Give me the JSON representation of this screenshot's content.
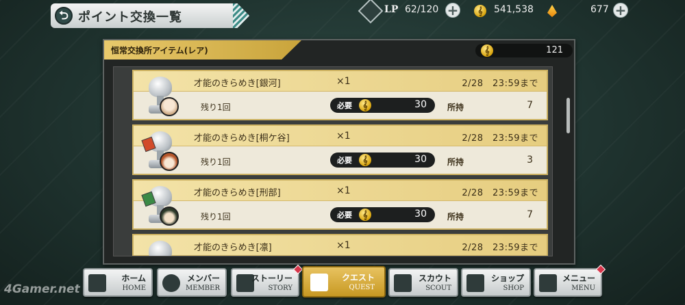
{
  "header": {
    "title": "ポイント交換一覧",
    "back_symbol": "⮌",
    "lp_label": "LP",
    "lp_value": "62/120",
    "coins_value": "541,538",
    "gems_value": "677",
    "plus_symbol": "+"
  },
  "panel": {
    "banner": "恒常交換所アイテム(レア)",
    "currency_value": "121",
    "currency_icon": "treble-clef-coin-icon",
    "coin_glyph": "𝄞"
  },
  "items": [
    {
      "name": "才能のきらめき[銀河]",
      "qty": "×1",
      "deadline": "2/28　23:59まで",
      "remaining": "残り1回",
      "required_label": "必要",
      "cost": "30",
      "owned_label": "所持",
      "owned": "7"
    },
    {
      "name": "才能のきらめき[桐ケ谷]",
      "qty": "×1",
      "deadline": "2/28　23:59まで",
      "remaining": "残り1回",
      "required_label": "必要",
      "cost": "30",
      "owned_label": "所持",
      "owned": "3"
    },
    {
      "name": "才能のきらめき[刑部]",
      "qty": "×1",
      "deadline": "2/28　23:59まで",
      "remaining": "残り1回",
      "required_label": "必要",
      "cost": "30",
      "owned_label": "所持",
      "owned": "7"
    },
    {
      "name": "才能のきらめき[凛]",
      "qty": "×1",
      "deadline": "2/28　23:59まで"
    }
  ],
  "nav": [
    {
      "jp": "ホーム",
      "en": "HOME"
    },
    {
      "jp": "メンバー",
      "en": "MEMBER"
    },
    {
      "jp": "ストーリー",
      "en": "STORY"
    },
    {
      "jp": "クエスト",
      "en": "QUEST"
    },
    {
      "jp": "スカウト",
      "en": "SCOUT"
    },
    {
      "jp": "ショップ",
      "en": "SHOP"
    },
    {
      "jp": "メニュー",
      "en": "MENU"
    }
  ],
  "watermark": "4Gamer.net",
  "colors": {
    "accent_gold": "#e6cd7f",
    "background": "#1f332f",
    "notification": "#d7354a"
  }
}
